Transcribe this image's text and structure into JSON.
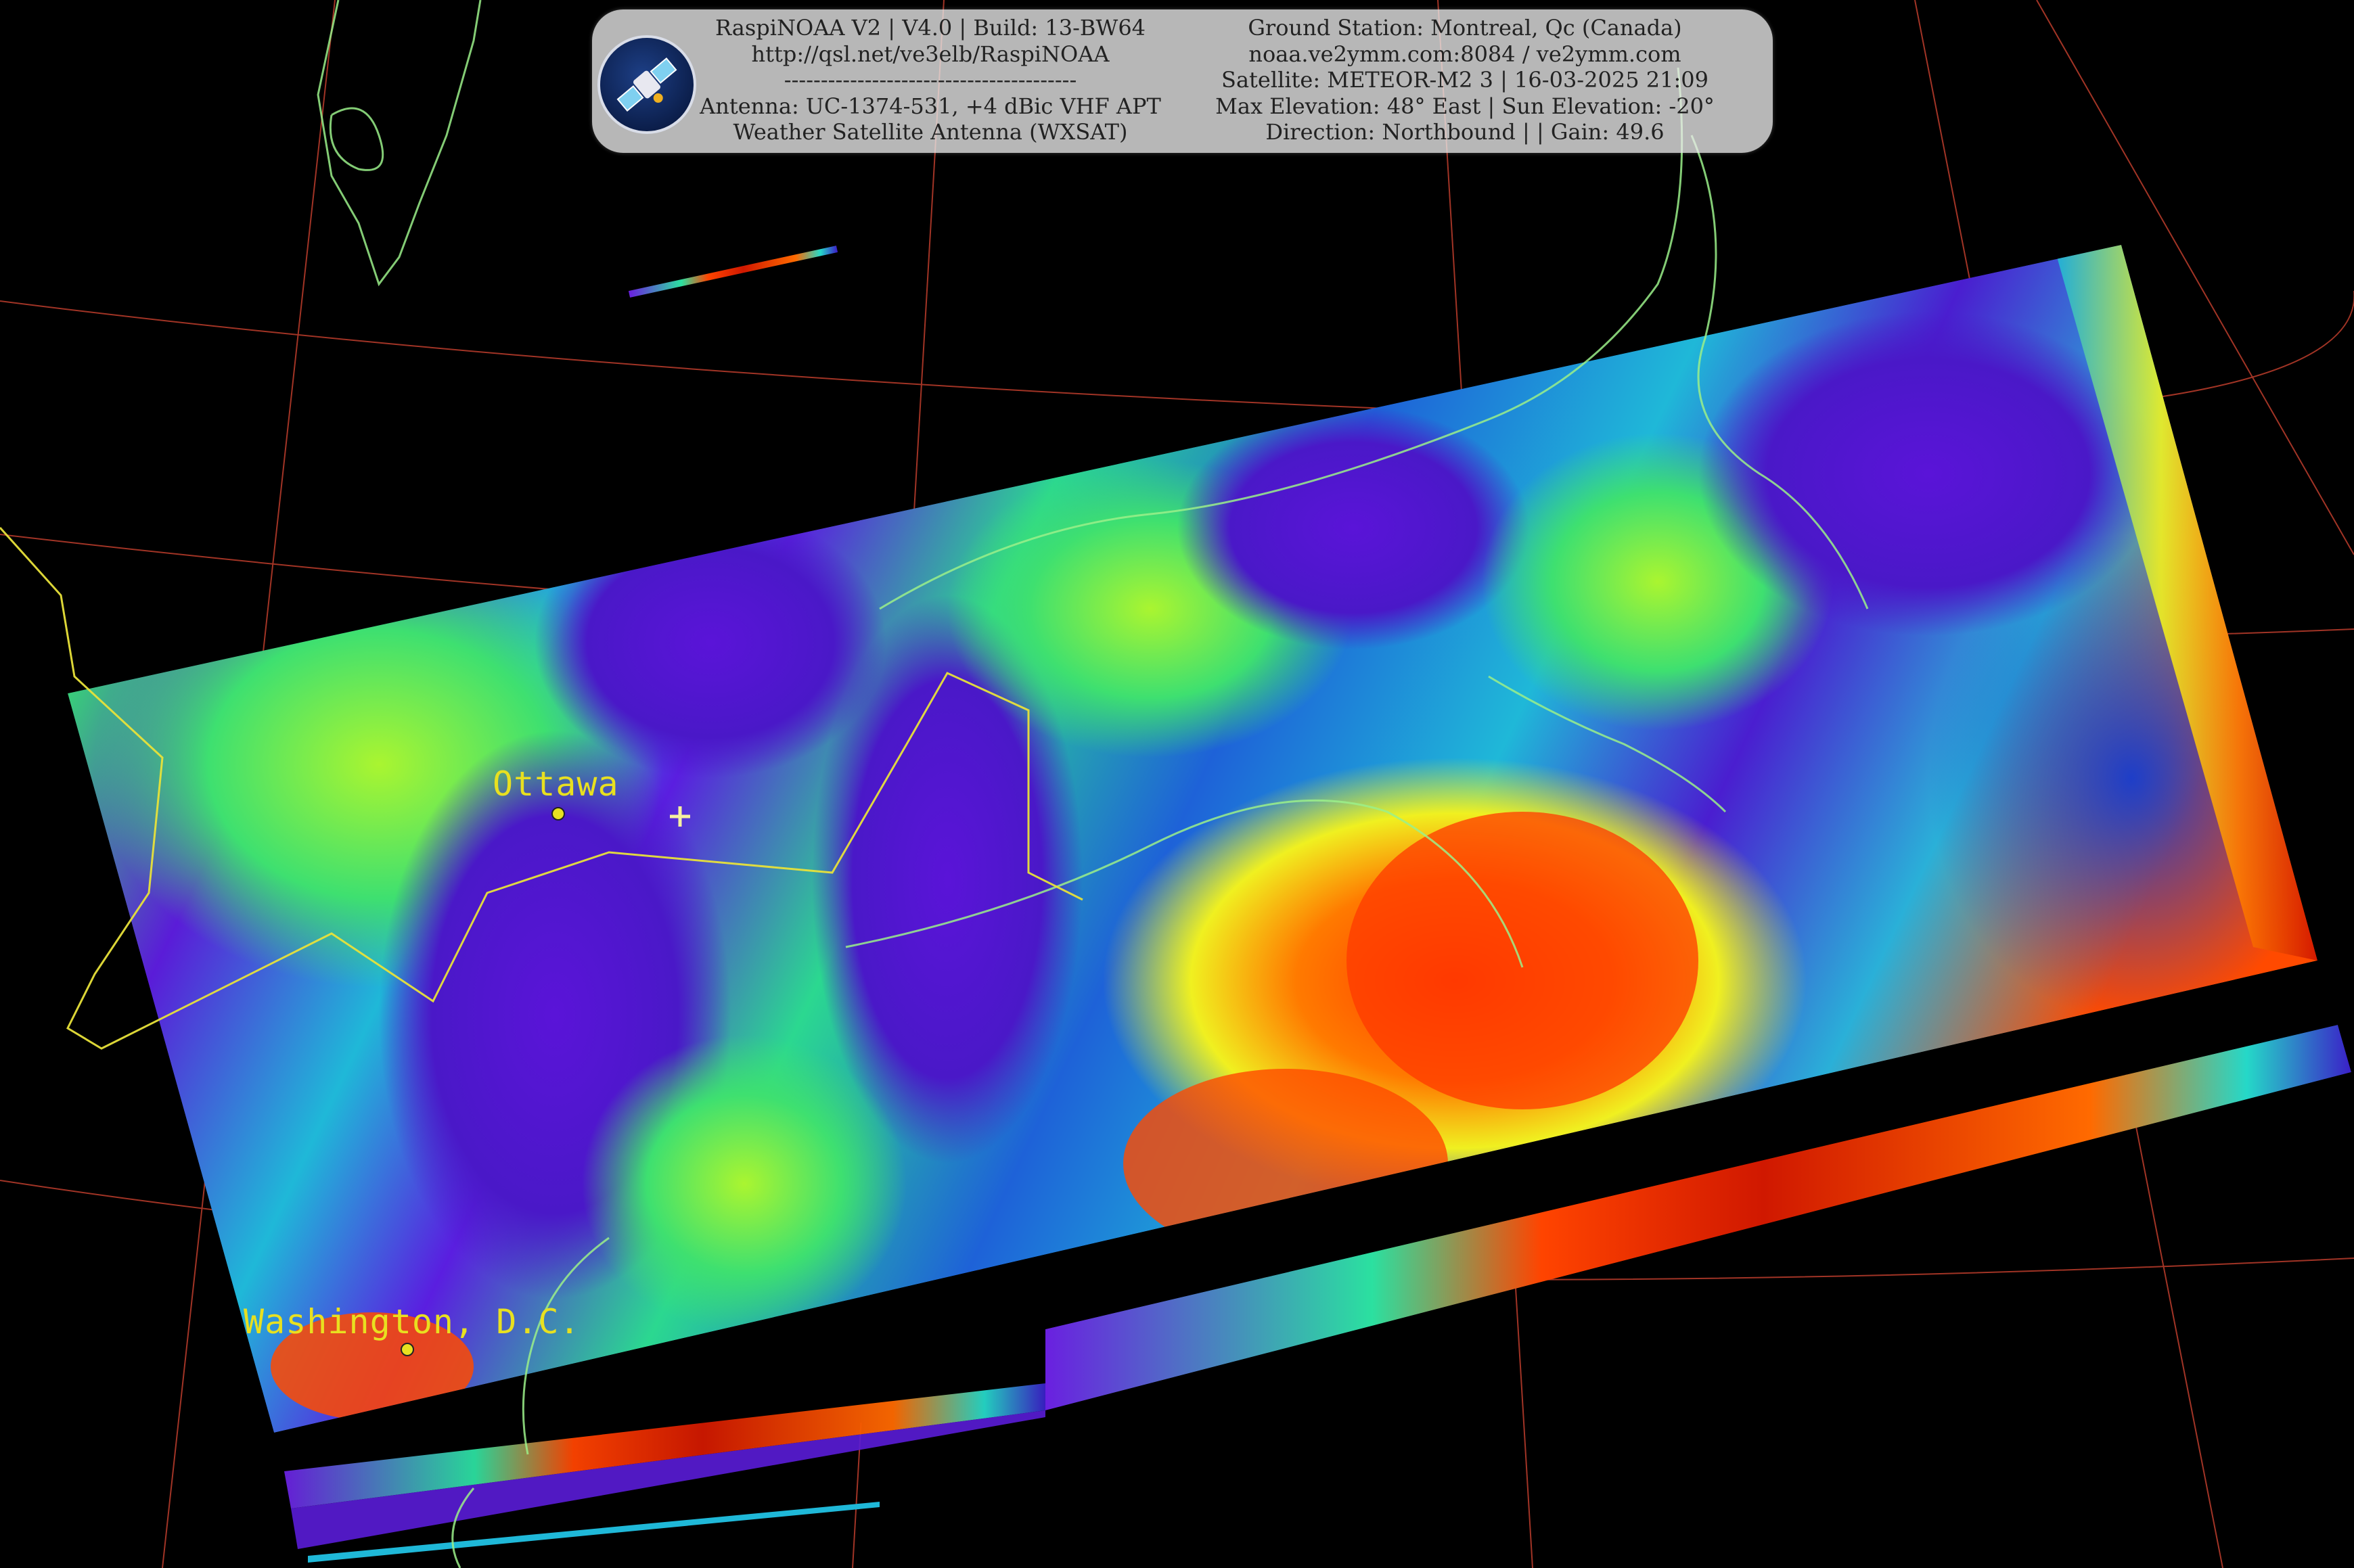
{
  "header": {
    "left_lines": [
      "RaspiNOAA V2 | V4.0 | Build: 13-BW64",
      "http://qsl.net/ve3elb/RaspiNOAA",
      "----------------------------------------",
      "Antenna: UC-1374-531, +4 dBic VHF APT",
      "Weather Satellite Antenna (WXSAT)"
    ],
    "right_lines": [
      "Ground Station: Montreal, Qc (Canada)",
      "noaa.ve2ymm.com:8084 / ve2ymm.com",
      "Satellite: METEOR-M2 3 | 16-03-2025 21:09",
      "Max Elevation: 48° East | Sun Elevation: -20°",
      "Direction: Northbound | | Gain: 49.6"
    ]
  },
  "cities": [
    {
      "name": "Ottawa"
    },
    {
      "name": "Washington, D.C."
    }
  ],
  "icons": {
    "logo": "satellite-icon",
    "station_marker": "plus-icon"
  },
  "colors": {
    "background": "#000000",
    "graticule": "#b33a2a",
    "coastline": "#9bf08a",
    "border": "#e8e23a",
    "label": "#e8e020",
    "palette": [
      "#3b10b8",
      "#6a1be0",
      "#1d55d8",
      "#1fb8d8",
      "#25e08a",
      "#8af02a",
      "#f0f020",
      "#ff9a10",
      "#ff3a00",
      "#c81400"
    ]
  }
}
